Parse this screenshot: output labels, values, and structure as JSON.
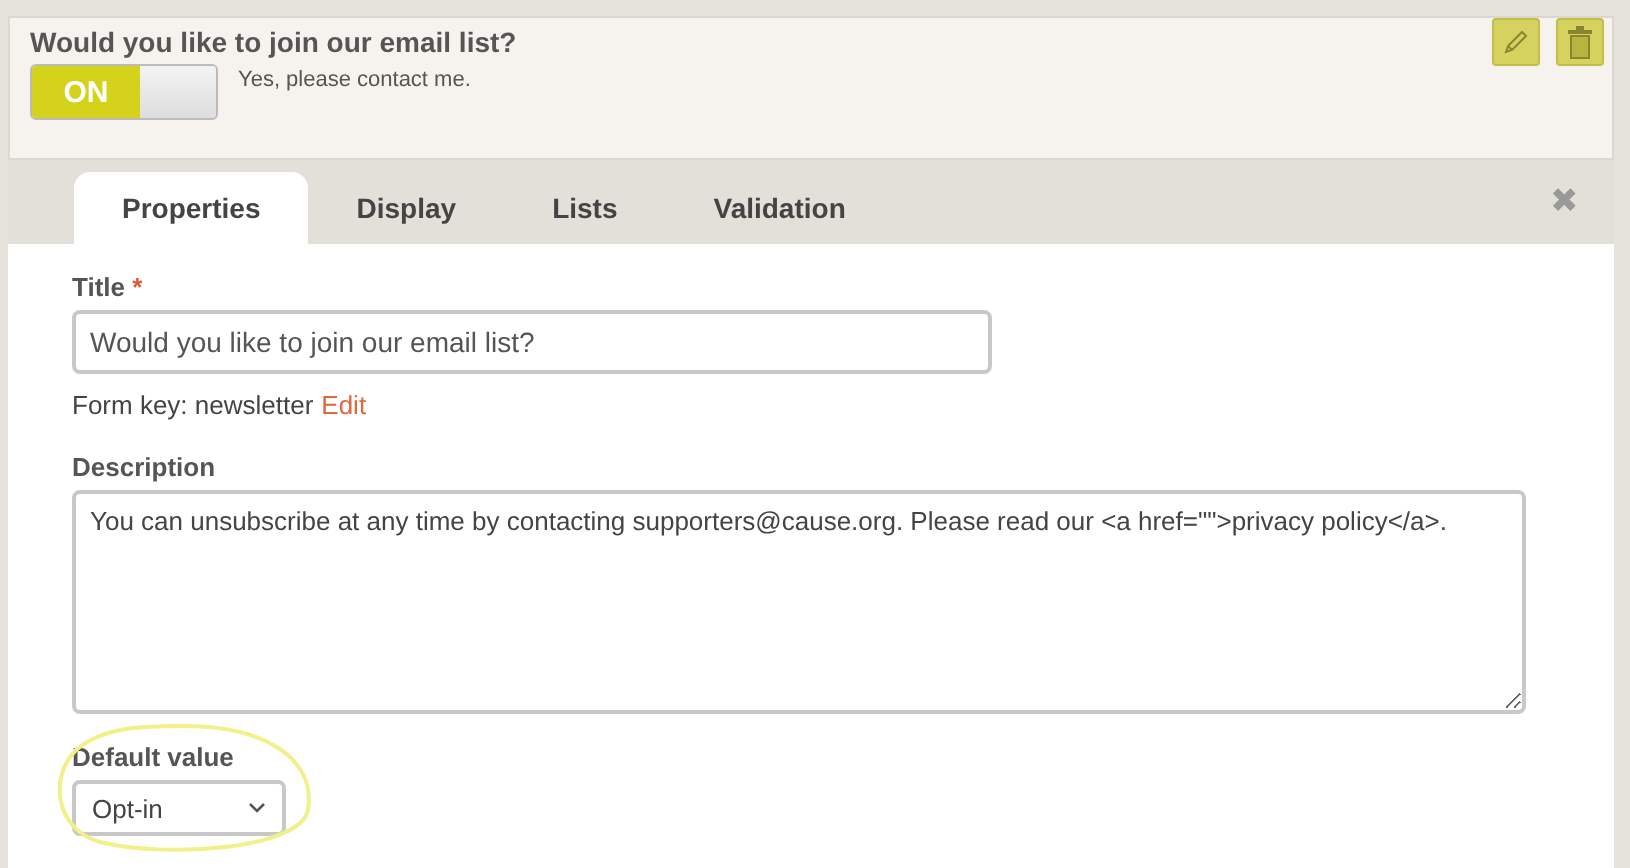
{
  "question": {
    "title": "Would you like to join our email list?",
    "toggle": {
      "on": true,
      "label": "ON"
    },
    "toggle_caption": "Yes, please contact me."
  },
  "tabs": [
    {
      "label": "Properties",
      "selected": true
    },
    {
      "label": "Display",
      "selected": false
    },
    {
      "label": "Lists",
      "selected": false
    },
    {
      "label": "Validation",
      "selected": false
    }
  ],
  "close_button": "✖",
  "form": {
    "title_label": "Title",
    "required_mark": "*",
    "title_value": "Would you like to join our email list?",
    "form_key_text": "Form key: newsletter",
    "form_key_link": "Edit",
    "description_label": "Description",
    "description_value": "You can unsubscribe at any time by contacting supporters@cause.org. Please read our <a href=\"\">privacy policy</a>.",
    "default_label": "Default value",
    "default_value": "Opt-in"
  }
}
